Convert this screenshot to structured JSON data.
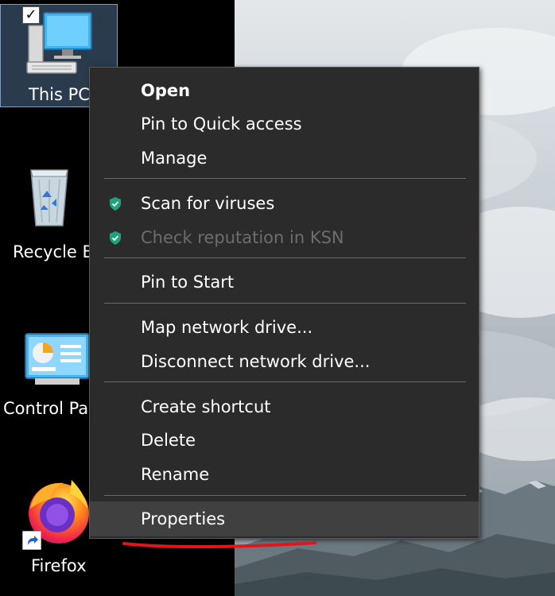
{
  "desktop": {
    "icons": [
      {
        "name": "This PC",
        "label": "This PC",
        "icon": "monitor-icon",
        "selected": true
      },
      {
        "name": "Recycle Bin",
        "label": "Recycle B",
        "icon": "recycle-bin-icon"
      },
      {
        "name": "Control Panel",
        "label": "Control Pa",
        "icon": "control-panel-icon"
      },
      {
        "name": "Firefox",
        "label": "Firefox",
        "icon": "firefox-icon"
      }
    ]
  },
  "context_menu": {
    "items": [
      {
        "label": "Open",
        "bold": true
      },
      {
        "label": "Pin to Quick access"
      },
      {
        "label": "Manage"
      },
      {
        "label": "Scan for viruses",
        "icon": "kaspersky-shield-icon"
      },
      {
        "label": "Check reputation in KSN",
        "icon": "kaspersky-shield-icon",
        "disabled": true
      },
      {
        "label": "Pin to Start"
      },
      {
        "label": "Map network drive..."
      },
      {
        "label": "Disconnect network drive..."
      },
      {
        "label": "Create shortcut"
      },
      {
        "label": "Delete"
      },
      {
        "label": "Rename"
      },
      {
        "label": "Properties",
        "highlighted": true
      }
    ]
  },
  "colors": {
    "menu_bg": "#2b2b2b",
    "menu_highlight": "#404040",
    "shield": "#1fa37c",
    "annotation": "#e0161c"
  }
}
